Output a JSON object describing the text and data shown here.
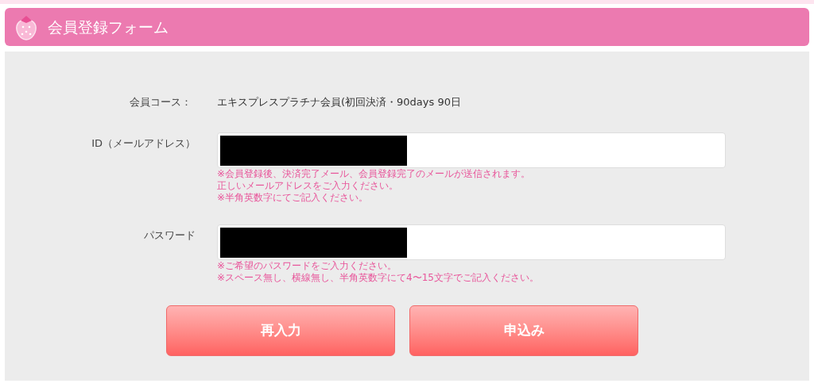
{
  "header": {
    "title": "会員登録フォーム"
  },
  "course": {
    "label": "会員コース：",
    "value": "エキスプレスプラチナ会員(初回決済・90days 90日"
  },
  "fields": [
    {
      "label": "ID（メールアドレス）",
      "redacted": true,
      "notes": [
        "※会員登録後、決済完了メール、会員登録完了のメールが送信されます。",
        "正しいメールアドレスをご入力ください。",
        "※半角英数字にてご記入ください。"
      ]
    },
    {
      "label": "パスワード",
      "redacted": true,
      "notes": [
        "※ご希望のパスワードをご入力ください。",
        "※スペース無し、横線無し、半角英数字にて4〜15文字でご記入ください。"
      ]
    }
  ],
  "buttons": [
    "再入力",
    "申込み"
  ]
}
